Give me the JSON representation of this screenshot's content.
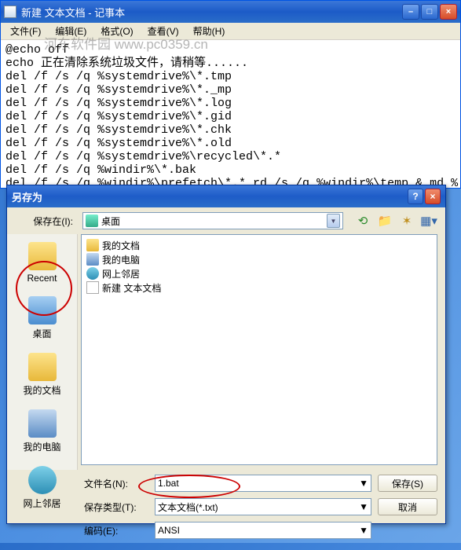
{
  "notepad": {
    "title": "新建 文本文档 - 记事本",
    "menu": {
      "file": "文件(F)",
      "edit": "编辑(E)",
      "format": "格式(O)",
      "view": "查看(V)",
      "help": "帮助(H)"
    },
    "content": "@echo off\necho 正在清除系统垃圾文件，请稍等......\ndel /f /s /q %systemdrive%\\*.tmp\ndel /f /s /q %systemdrive%\\*._mp\ndel /f /s /q %systemdrive%\\*.log\ndel /f /s /q %systemdrive%\\*.gid\ndel /f /s /q %systemdrive%\\*.chk\ndel /f /s /q %systemdrive%\\*.old\ndel /f /s /q %systemdrive%\\recycled\\*.*\ndel /f /s /q %windir%\\*.bak\ndel /f /s /q %windir%\\prefetch\\*.* rd /s /q %windir%\\temp & md %"
  },
  "watermark": "河东软件园  www.pc0359.cn",
  "dialog": {
    "title": "另存为",
    "savein_label": "保存在(I):",
    "savein_value": "桌面",
    "places": {
      "recent": "Recent",
      "desktop": "桌面",
      "mydocs": "我的文档",
      "mycomp": "我的电脑",
      "netplaces": "网上邻居"
    },
    "files": [
      {
        "icon": "foldericon",
        "name": "我的文档"
      },
      {
        "icon": "compicon",
        "name": "我的电脑"
      },
      {
        "icon": "neticon",
        "name": "网上邻居"
      },
      {
        "icon": "txticon",
        "name": "新建 文本文档"
      }
    ],
    "filename_label": "文件名(N):",
    "filename_value": "1.bat",
    "filetype_label": "保存类型(T):",
    "filetype_value": "文本文档(*.txt)",
    "encoding_label": "编码(E):",
    "encoding_value": "ANSI",
    "save_btn": "保存(S)",
    "cancel_btn": "取消"
  }
}
